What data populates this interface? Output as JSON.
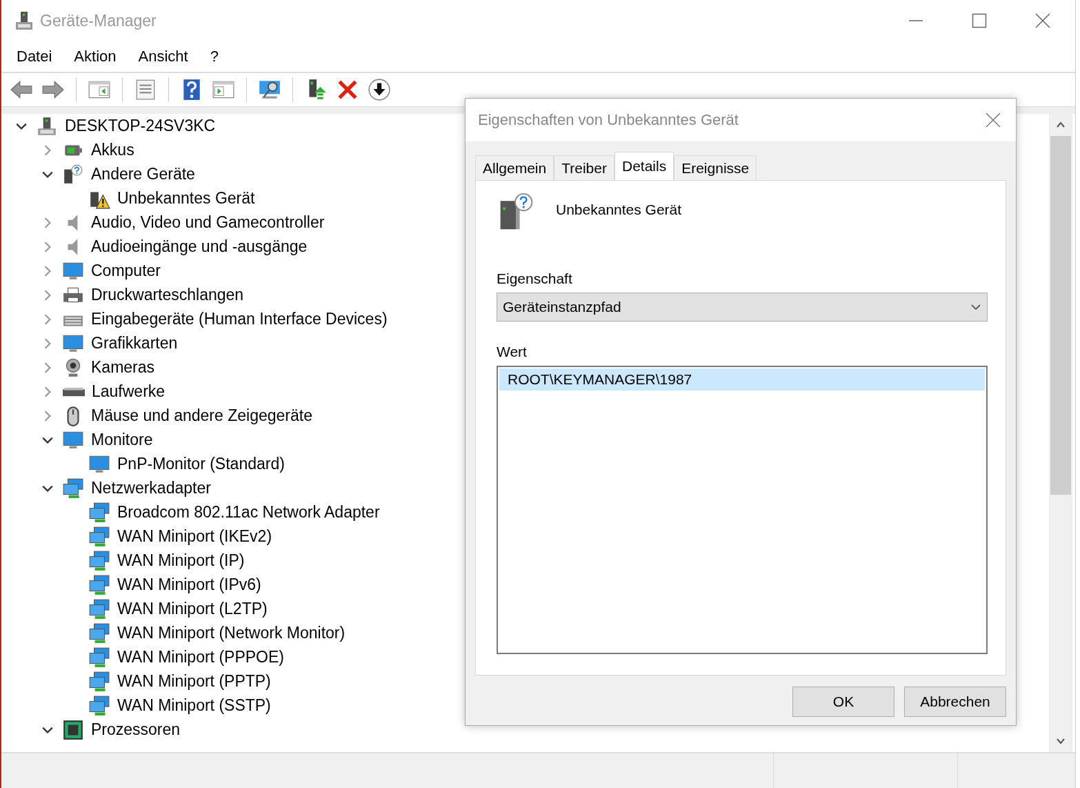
{
  "window": {
    "title": "Geräte-Manager"
  },
  "menu": [
    "Datei",
    "Aktion",
    "Ansicht",
    "?"
  ],
  "tree": {
    "label": "DESKTOP-24SV3KC",
    "expanded": true,
    "children": [
      {
        "label": "Akkus",
        "expanded": false
      },
      {
        "label": "Andere Geräte",
        "expanded": true,
        "children": [
          {
            "label": "Unbekanntes Gerät"
          }
        ]
      },
      {
        "label": "Audio, Video und Gamecontroller",
        "expanded": false
      },
      {
        "label": "Audioeingänge und -ausgänge",
        "expanded": false
      },
      {
        "label": "Computer",
        "expanded": false
      },
      {
        "label": "Druckwarteschlangen",
        "expanded": false
      },
      {
        "label": "Eingabegeräte (Human Interface Devices)",
        "expanded": false
      },
      {
        "label": "Grafikkarten",
        "expanded": false
      },
      {
        "label": "Kameras",
        "expanded": false
      },
      {
        "label": "Laufwerke",
        "expanded": false
      },
      {
        "label": "Mäuse und andere Zeigegeräte",
        "expanded": false
      },
      {
        "label": "Monitore",
        "expanded": true,
        "children": [
          {
            "label": "PnP-Monitor (Standard)"
          }
        ]
      },
      {
        "label": "Netzwerkadapter",
        "expanded": true,
        "children": [
          {
            "label": "Broadcom 802.11ac Network Adapter"
          },
          {
            "label": "WAN Miniport (IKEv2)"
          },
          {
            "label": "WAN Miniport (IP)"
          },
          {
            "label": "WAN Miniport (IPv6)"
          },
          {
            "label": "WAN Miniport (L2TP)"
          },
          {
            "label": "WAN Miniport (Network Monitor)"
          },
          {
            "label": "WAN Miniport (PPPOE)"
          },
          {
            "label": "WAN Miniport (PPTP)"
          },
          {
            "label": "WAN Miniport (SSTP)"
          }
        ]
      },
      {
        "label": "Prozessoren",
        "expanded": true
      }
    ]
  },
  "dialog": {
    "title": "Eigenschaften von Unbekanntes Gerät",
    "tabs": [
      {
        "label": "Allgemein",
        "selected": false
      },
      {
        "label": "Treiber",
        "selected": false
      },
      {
        "label": "Details",
        "selected": true
      },
      {
        "label": "Ereignisse",
        "selected": false
      }
    ],
    "device_name": "Unbekanntes Gerät",
    "property_label": "Eigenschaft",
    "property_value": "Geräteinstanzpfad",
    "value_label": "Wert",
    "values": [
      {
        "text": "ROOT\\KEYMANAGER\\1987",
        "selected": true
      }
    ],
    "buttons": [
      "OK",
      "Abbrechen"
    ]
  }
}
